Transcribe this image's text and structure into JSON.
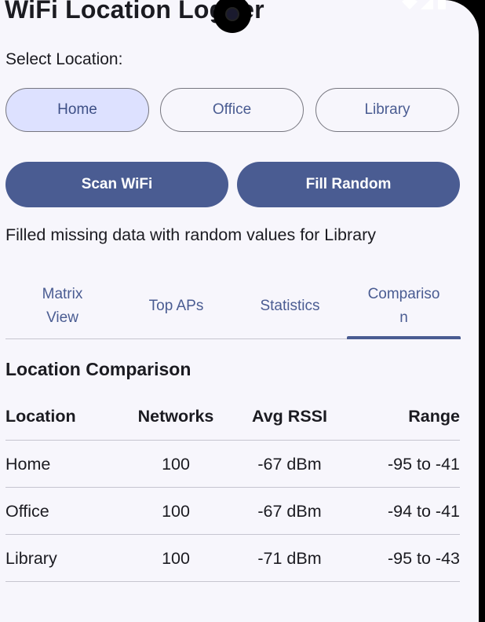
{
  "app": {
    "title": "WiFi Location Logger"
  },
  "select_location": {
    "label": "Select Location:",
    "options": [
      "Home",
      "Office",
      "Library"
    ],
    "selected": "Home"
  },
  "actions": {
    "scan": "Scan WiFi",
    "fill": "Fill Random"
  },
  "status_message": "Filled missing data with random values for Library",
  "tabs": [
    "Matrix View",
    "Top APs",
    "Statistics",
    "Comparison"
  ],
  "active_tab": "Comparison",
  "comparison": {
    "title": "Location Comparison",
    "columns": [
      "Location",
      "Networks",
      "Avg RSSI",
      "Range"
    ],
    "rows": [
      [
        "Home",
        "100",
        "-67 dBm",
        "-95 to -41"
      ],
      [
        "Office",
        "100",
        "-67 dBm",
        "-94 to -41"
      ],
      [
        "Library",
        "100",
        "-71 dBm",
        "-95 to -43"
      ]
    ]
  },
  "colors": {
    "primary": "#4a5c92",
    "selected_bg": "#dde1ff",
    "background": "#f7f6fc"
  }
}
